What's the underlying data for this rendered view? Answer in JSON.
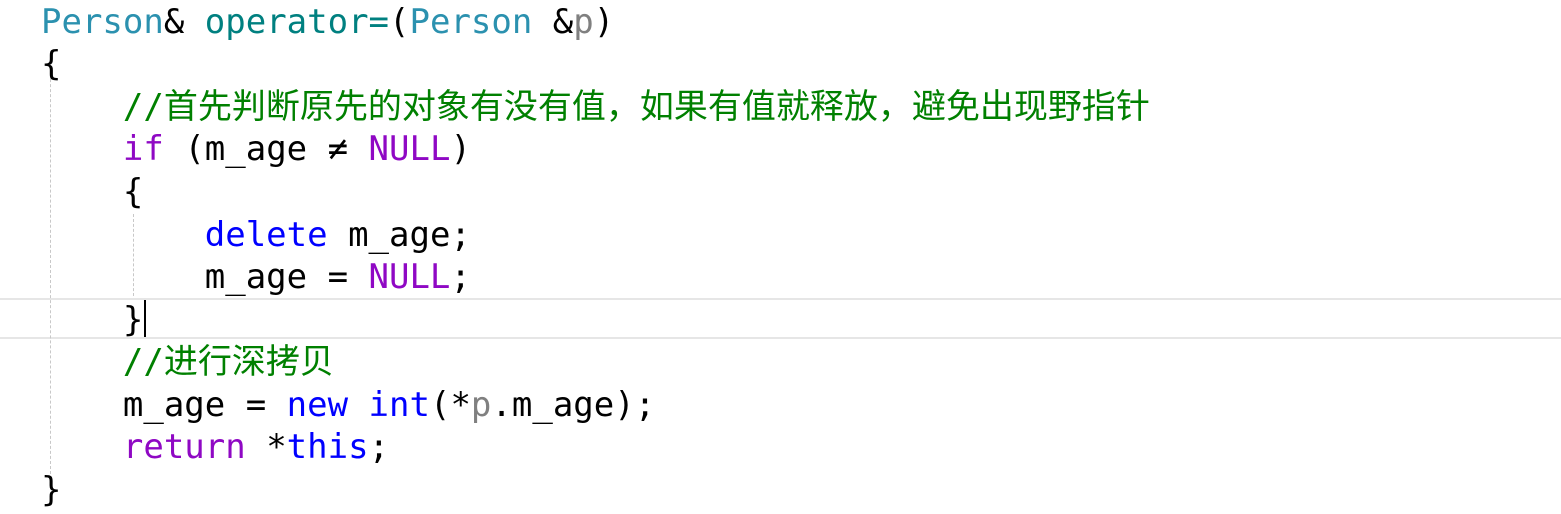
{
  "editor": {
    "lines": [
      [
        {
          "t": "Person",
          "c": "type"
        },
        {
          "t": "& ",
          "c": "plain"
        },
        {
          "t": "operator=",
          "c": "func"
        },
        {
          "t": "(",
          "c": "plain"
        },
        {
          "t": "Person",
          "c": "type"
        },
        {
          "t": " &",
          "c": "plain"
        },
        {
          "t": "p",
          "c": "param"
        },
        {
          "t": ")",
          "c": "plain"
        }
      ],
      [
        {
          "t": "{",
          "c": "plain"
        }
      ],
      [
        {
          "t": "    ",
          "c": "plain"
        },
        {
          "t": "//首先判断原先的对象有没有值，如果有值就释放，避免出现野指针",
          "c": "comment"
        }
      ],
      [
        {
          "t": "    ",
          "c": "plain"
        },
        {
          "t": "if",
          "c": "kw-purple"
        },
        {
          "t": " (m_age ≠ ",
          "c": "plain"
        },
        {
          "t": "NULL",
          "c": "macro"
        },
        {
          "t": ")",
          "c": "plain"
        }
      ],
      [
        {
          "t": "    {",
          "c": "plain"
        }
      ],
      [
        {
          "t": "        ",
          "c": "plain"
        },
        {
          "t": "delete",
          "c": "kw-blue"
        },
        {
          "t": " m_age;",
          "c": "plain"
        }
      ],
      [
        {
          "t": "        m_age = ",
          "c": "plain"
        },
        {
          "t": "NULL",
          "c": "macro"
        },
        {
          "t": ";",
          "c": "plain"
        }
      ],
      [
        {
          "t": "    }",
          "c": "plain"
        }
      ],
      [
        {
          "t": "    ",
          "c": "plain"
        },
        {
          "t": "//进行深拷贝",
          "c": "comment"
        }
      ],
      [
        {
          "t": "    m_age = ",
          "c": "plain"
        },
        {
          "t": "new",
          "c": "kw-blue"
        },
        {
          "t": " ",
          "c": "plain"
        },
        {
          "t": "int",
          "c": "kw-blue"
        },
        {
          "t": "(*",
          "c": "plain"
        },
        {
          "t": "p",
          "c": "param"
        },
        {
          "t": ".m_age);",
          "c": "plain"
        }
      ],
      [
        {
          "t": "    ",
          "c": "plain"
        },
        {
          "t": "return",
          "c": "kw-purple"
        },
        {
          "t": " *",
          "c": "plain"
        },
        {
          "t": "this",
          "c": "kw-blue"
        },
        {
          "t": ";",
          "c": "plain"
        }
      ],
      [
        {
          "t": "}",
          "c": "plain"
        }
      ]
    ]
  }
}
